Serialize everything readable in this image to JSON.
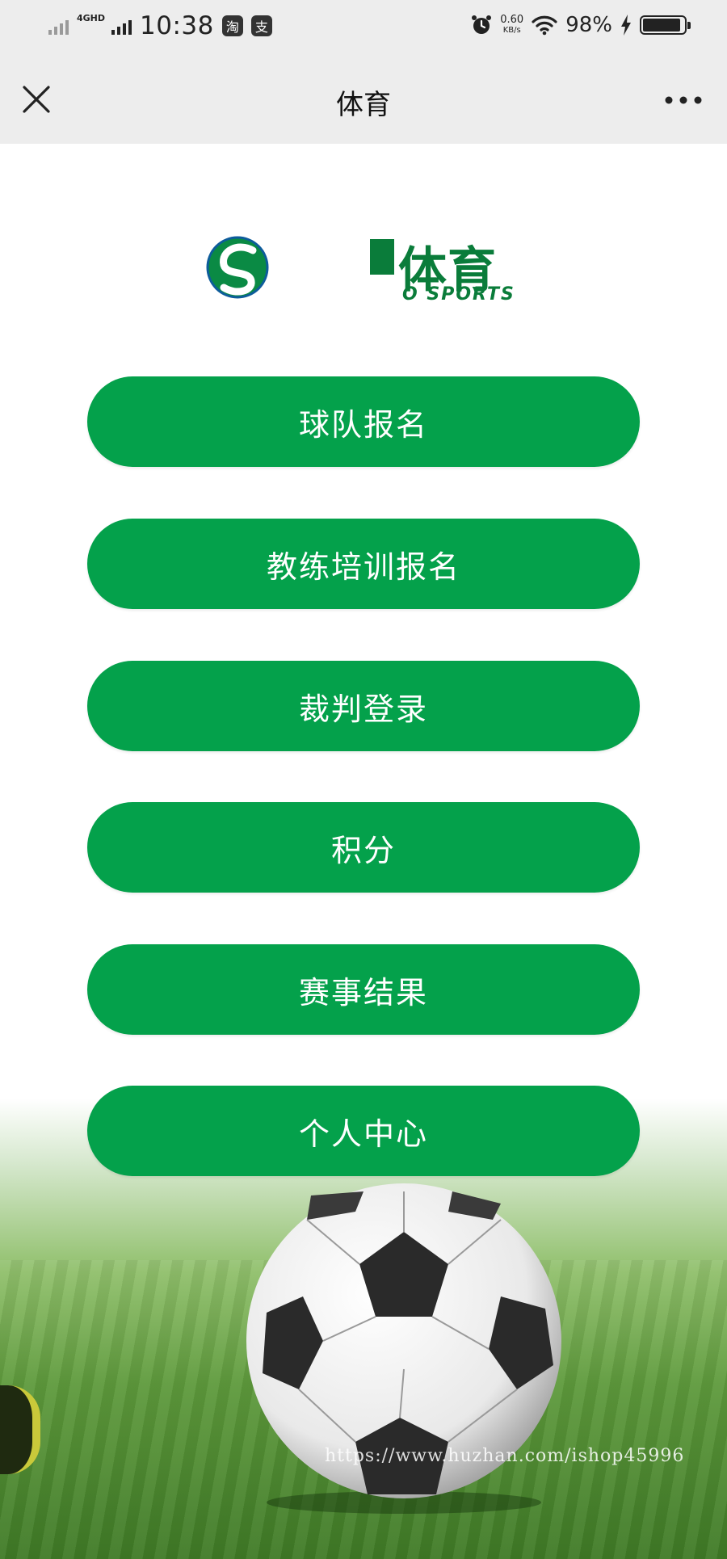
{
  "status_bar": {
    "network_label": "4GHD",
    "time": "10:38",
    "app_icons": [
      "淘",
      "支"
    ],
    "speed_value": "0.60",
    "speed_unit": "KB/s",
    "battery_percent": "98%",
    "battery_level": 0.98
  },
  "title_bar": {
    "title": "体育",
    "icons": [
      "close-icon",
      "more-icon"
    ]
  },
  "logo": {
    "cn_text": "体育",
    "en_text": "O SPORTS"
  },
  "menu": {
    "items": [
      {
        "label": "球队报名"
      },
      {
        "label": "教练培训报名"
      },
      {
        "label": "裁判登录"
      },
      {
        "label": "积分"
      },
      {
        "label": "赛事结果"
      },
      {
        "label": "个人中心"
      }
    ]
  },
  "watermark": "https://www.huzhan.com/ishop45996",
  "colors": {
    "button": "#04a14b",
    "logo_green": "#0a7c3a",
    "bar_bg": "#ededed"
  }
}
